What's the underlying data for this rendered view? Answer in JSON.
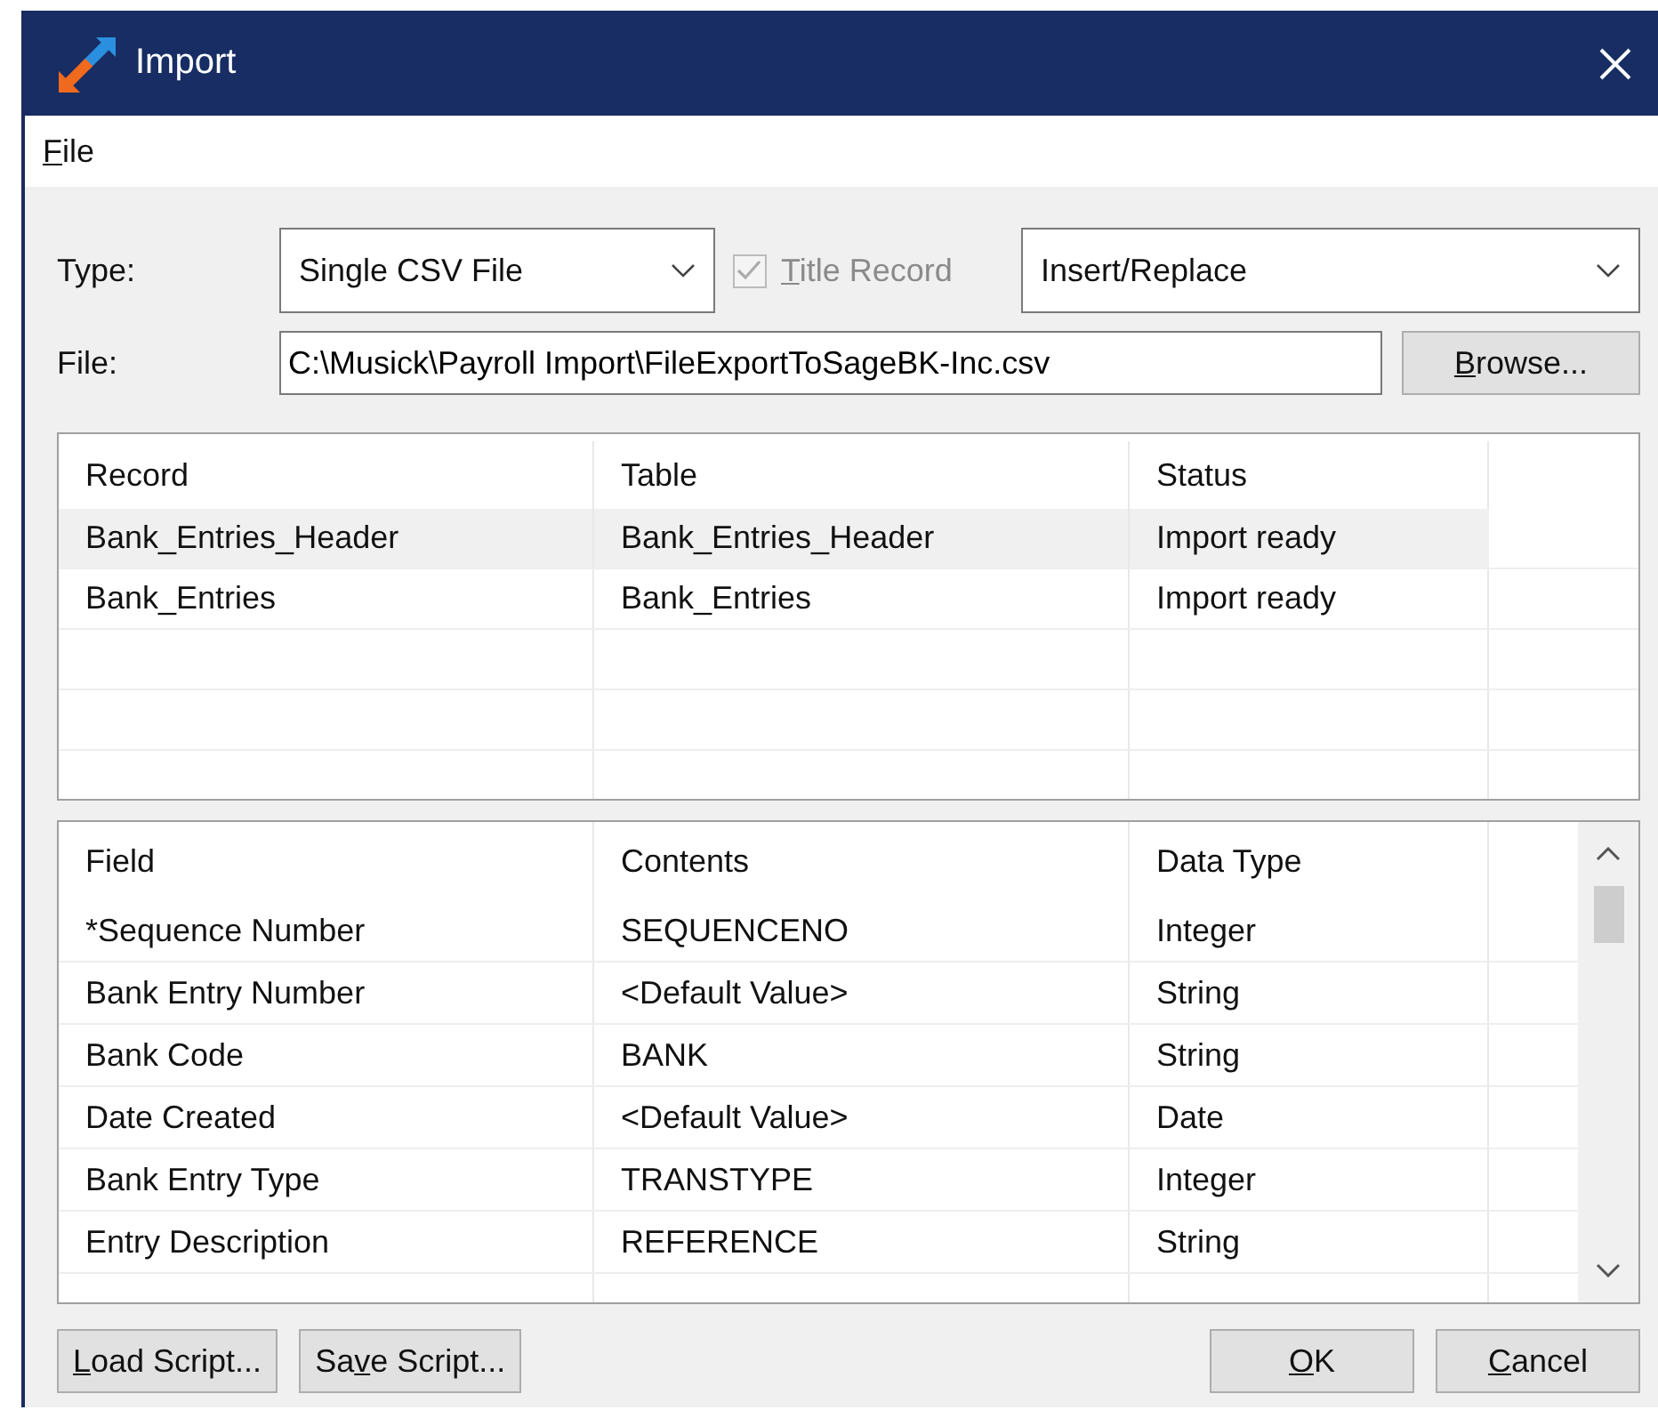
{
  "window": {
    "title": "Import"
  },
  "menu": [
    {
      "key": "F",
      "after": "ile"
    }
  ],
  "type_label": "Type:",
  "type_combo": {
    "value": "Single CSV File"
  },
  "title_record": {
    "key": "T",
    "after": "itle Record",
    "checked": true,
    "disabled": true
  },
  "mode_combo": {
    "value": "Insert/Replace"
  },
  "file_label": "File:",
  "file_field": {
    "value": "C:\\Musick\\Payroll Import\\FileExportToSageBK-Inc.csv"
  },
  "browse_button": {
    "key": "B",
    "after": "rowse..."
  },
  "records": {
    "columns": [
      "Record",
      "Table",
      "Status"
    ],
    "rows": [
      {
        "cells": [
          "Bank_Entries_Header",
          "Bank_Entries_Header",
          "Import ready"
        ],
        "selected": true
      },
      {
        "cells": [
          "Bank_Entries",
          "Bank_Entries",
          "Import ready"
        ],
        "selected": false
      }
    ]
  },
  "fields": {
    "columns": [
      "Field",
      "Contents",
      "Data Type"
    ],
    "rows": [
      [
        "*Sequence Number",
        "SEQUENCENO",
        "Integer"
      ],
      [
        "Bank Entry Number",
        "<Default Value>",
        "String"
      ],
      [
        "Bank Code",
        "BANK",
        "String"
      ],
      [
        "Date Created",
        "<Default Value>",
        "Date"
      ],
      [
        "Bank Entry Type",
        "TRANSTYPE",
        "Integer"
      ],
      [
        "Entry Description",
        "REFERENCE",
        "String"
      ]
    ]
  },
  "left_buttons": [
    {
      "key": "L",
      "after": "oad Script..."
    },
    {
      "before": "Sa",
      "key": "v",
      "after": "e Script..."
    }
  ],
  "right_buttons": [
    {
      "key": "O",
      "after": "K"
    },
    {
      "key": "C",
      "after": "ancel"
    }
  ]
}
